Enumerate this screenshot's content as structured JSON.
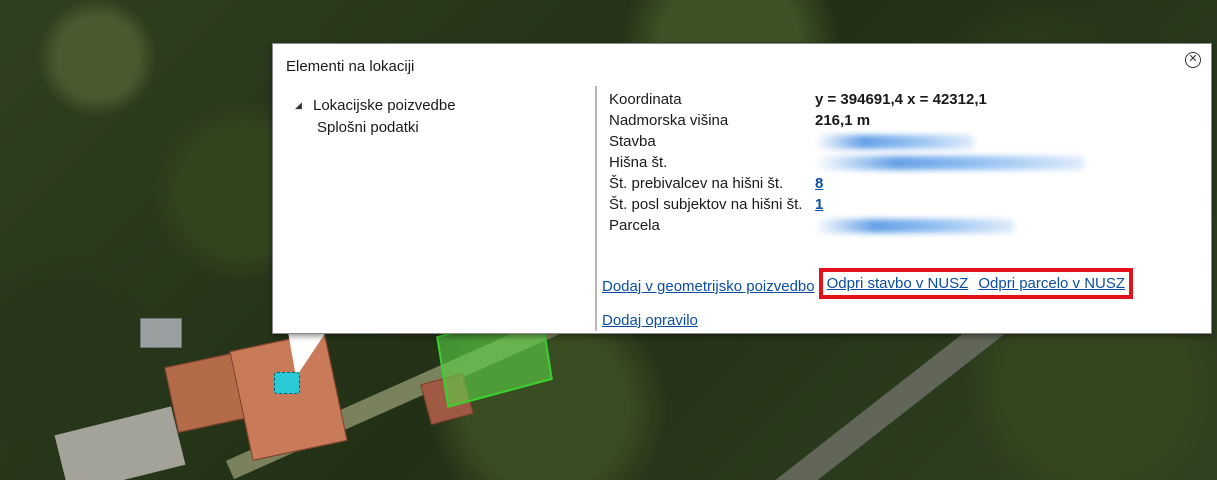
{
  "popup": {
    "title": "Elementi na lokaciji",
    "close_icon": "close-circle-icon"
  },
  "tree": {
    "root_label": "Lokacijske poizvedbe",
    "child_label": "Splošni podatki"
  },
  "properties": {
    "coord_label": "Koordinata",
    "coord_value": "y = 394691,4 x = 42312,1",
    "elevation_label": "Nadmorska višina",
    "elevation_value": "216,1 m",
    "building_label": "Stavba",
    "house_no_label": "Hišna št.",
    "residents_label": "Št. prebivalcev na hišni št.",
    "residents_value": "8",
    "business_label": "Št. posl subjektov na hišni št.",
    "business_value": "1",
    "parcel_label": "Parcela"
  },
  "actions": {
    "add_geo_query": "Dodaj v geometrijsko poizvedbo",
    "open_building_nusz": "Odpri stavbo v NUSZ",
    "open_parcel_nusz": "Odpri parcelo v NUSZ",
    "add_task": "Dodaj opravilo"
  },
  "colors": {
    "link": "#0b4ea2",
    "highlight_box": "#e3111b",
    "parcel_fill": "#5ad246",
    "marker": "#29c9d6"
  }
}
